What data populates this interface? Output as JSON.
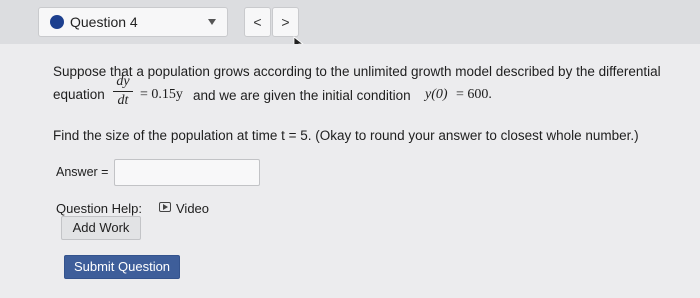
{
  "toolbar": {
    "question_label": "Question 4",
    "prev_label": "<",
    "next_label": ">"
  },
  "problem": {
    "line1": "Suppose that a population grows according to the unlimited growth model described by the differential",
    "line2_prefix": "equation",
    "frac_num": "dy",
    "frac_den": "dt",
    "eq_rhs": "= 0.15y",
    "line2_mid": "and we are given the initial condition",
    "ic_lhs": "y(0)",
    "ic_rhs": "= 600.",
    "question": "Find the size of the population at time t = 5. (Okay to round your answer to closest whole number.)"
  },
  "answer": {
    "label": "Answer =",
    "value": ""
  },
  "help": {
    "label": "Question Help:",
    "video_label": "Video",
    "add_work_label": "Add Work"
  },
  "submit_label": "Submit Question"
}
